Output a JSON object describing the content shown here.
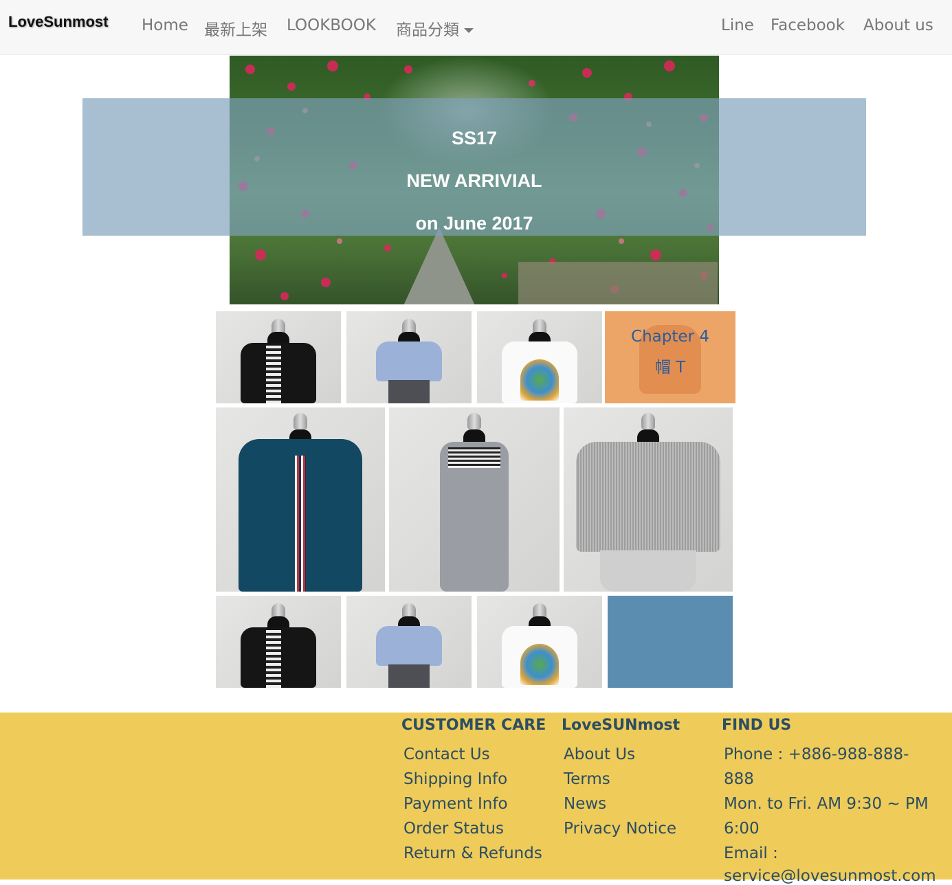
{
  "navbar": {
    "brand": "LoveSunmost",
    "links_left": [
      "Home",
      "最新上架",
      "LOOKBOOK",
      "商品分類"
    ],
    "links_right": [
      "Line",
      "Facebook",
      "About us"
    ]
  },
  "hero": {
    "line1": "SS17",
    "line2": "NEW ARRIVIAL",
    "line3": "on June 2017"
  },
  "chapter_tile": {
    "line1": "Chapter 4",
    "line2": "帽 T"
  },
  "colors": {
    "navbar_bg": "#f7f7f7",
    "hero_band": "#7da1ba",
    "chapter_tile": "#eca567",
    "chapter_text": "#2a5c9c",
    "blue_tile": "#5b8db0",
    "footer_bg": "#efcb59",
    "footer_text": "#2b4e63"
  },
  "footer": {
    "customer_care": {
      "heading": "CUSTOMER CARE",
      "links": [
        "Contact Us",
        "Shipping Info",
        "Payment Info",
        "Order Status",
        "Return & Refunds"
      ]
    },
    "lovesunmost": {
      "heading": "LoveSUNmost",
      "links": [
        "About Us",
        "Terms",
        "News",
        "Privacy Notice"
      ]
    },
    "find_us": {
      "heading": "FIND US",
      "lines": [
        "Phone : +886-988-888-",
        "888",
        "Mon. to Fri. AM 9:30 ~ PM",
        "6:00",
        "Email :",
        "service@lovesunmost.com"
      ]
    }
  }
}
